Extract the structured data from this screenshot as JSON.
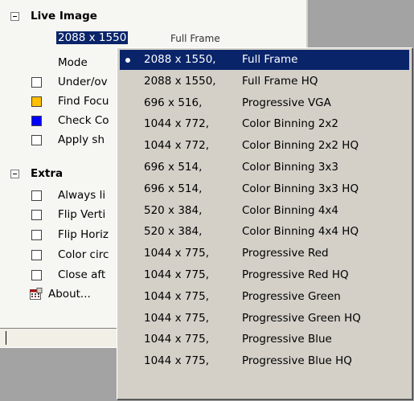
{
  "tree": {
    "group1": {
      "label": "Live Image"
    },
    "resolution_value": "2088 x 1550",
    "resolution_suffix": "Full Frame",
    "mode_label": "Mode",
    "items": [
      {
        "label": "Under/ov",
        "checkbox": "plain"
      },
      {
        "label": "Find Focu",
        "checkbox": "color",
        "color": "#ffc000"
      },
      {
        "label": "Check Co",
        "checkbox": "color",
        "color": "#0000ff"
      },
      {
        "label": "Apply sh",
        "checkbox": "plain"
      }
    ],
    "group2": {
      "label": "Extra"
    },
    "extra_items": [
      {
        "label": "Always li"
      },
      {
        "label": "Flip Verti"
      },
      {
        "label": "Flip Horiz"
      },
      {
        "label": "Color circ"
      },
      {
        "label": "Close aft"
      }
    ],
    "about_label": "About..."
  },
  "dropdown": {
    "selected_index": 0,
    "options": [
      {
        "res": "2088 x 1550,",
        "name": "Full Frame"
      },
      {
        "res": "2088 x 1550,",
        "name": "Full Frame HQ"
      },
      {
        "res": "696 x 516,",
        "name": "Progressive VGA"
      },
      {
        "res": "1044 x 772,",
        "name": "Color Binning 2x2"
      },
      {
        "res": "1044 x 772,",
        "name": "Color Binning 2x2 HQ"
      },
      {
        "res": "696 x 514,",
        "name": "Color Binning 3x3"
      },
      {
        "res": "696 x 514,",
        "name": "Color Binning 3x3 HQ"
      },
      {
        "res": "520 x 384,",
        "name": "Color Binning 4x4"
      },
      {
        "res": "520 x 384,",
        "name": "Color Binning 4x4 HQ"
      },
      {
        "res": "1044 x 775,",
        "name": "Progressive Red"
      },
      {
        "res": "1044 x 775,",
        "name": "Progressive Red HQ"
      },
      {
        "res": "1044 x 775,",
        "name": "Progressive Green"
      },
      {
        "res": "1044 x 775,",
        "name": "Progressive Green HQ"
      },
      {
        "res": "1044 x 775,",
        "name": "Progressive Blue"
      },
      {
        "res": "1044 x 775,",
        "name": "Progressive Blue HQ"
      }
    ]
  },
  "colors": {
    "selection": "#0a246a",
    "menu_bg": "#d4d0c8",
    "panel_bg": "#f6f6f3"
  }
}
